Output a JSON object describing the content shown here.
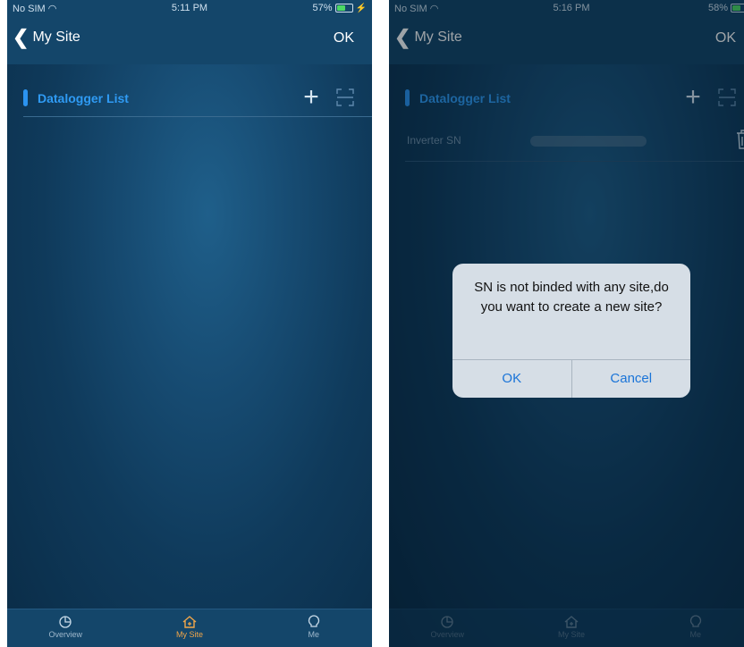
{
  "screens": [
    {
      "status": {
        "carrier": "No SIM",
        "time": "5:11 PM",
        "battery": "57%"
      },
      "nav": {
        "back_label": "My Site",
        "ok_label": "OK"
      },
      "section": {
        "title": "Datalogger List"
      },
      "tabs": [
        {
          "label": "Overview",
          "icon": "pie-chart-icon",
          "active": false
        },
        {
          "label": "My Site",
          "icon": "home-icon",
          "active": true
        },
        {
          "label": "Me",
          "icon": "bulb-icon",
          "active": false
        }
      ]
    },
    {
      "status": {
        "carrier": "No SIM",
        "time": "5:16 PM",
        "battery": "58%"
      },
      "nav": {
        "back_label": "My Site",
        "ok_label": "OK"
      },
      "section": {
        "title": "Datalogger List"
      },
      "list": [
        {
          "label": "Inverter SN",
          "value": ""
        }
      ],
      "dialog": {
        "message": "SN is not binded with any site,do you want to create a new site?",
        "ok_label": "OK",
        "cancel_label": "Cancel"
      },
      "tabs": [
        {
          "label": "Overview",
          "icon": "pie-chart-icon",
          "active": false
        },
        {
          "label": "My Site",
          "icon": "home-icon",
          "active": true
        },
        {
          "label": "Me",
          "icon": "bulb-icon",
          "active": false
        }
      ]
    }
  ],
  "colors": {
    "accent": "#2b93f0",
    "bar": "#14466a",
    "tab_active": "#f0a64a",
    "dialog_button": "#1a74d8"
  }
}
